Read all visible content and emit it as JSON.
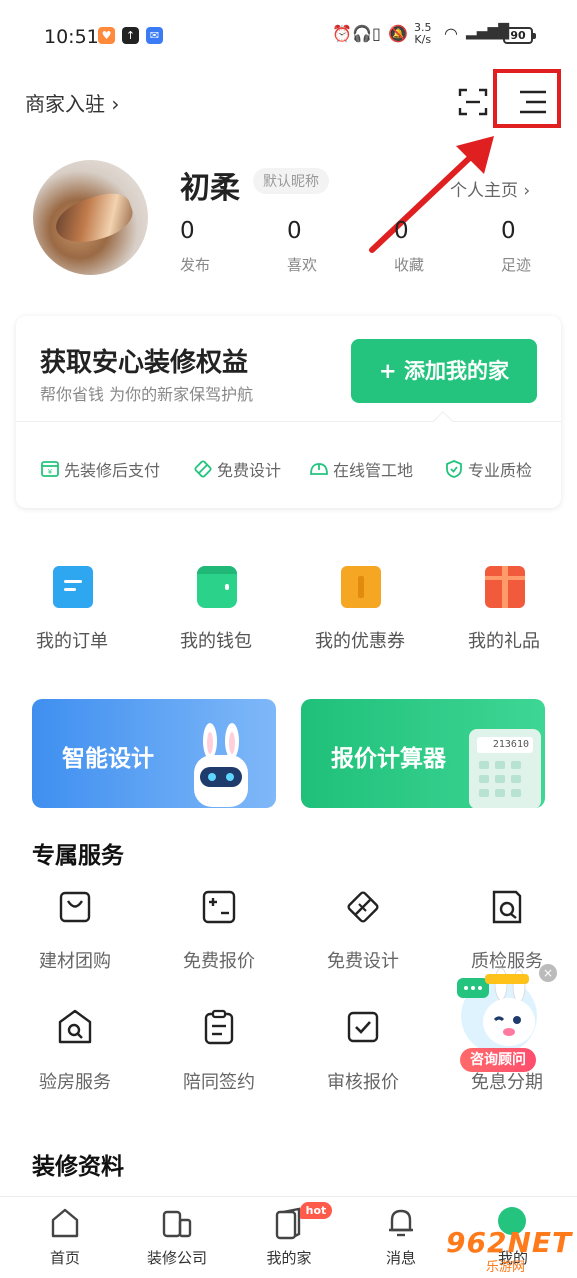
{
  "status_bar": {
    "time": "10:51",
    "net_speed_value": "3.5",
    "net_speed_unit": "K/s",
    "battery": "90"
  },
  "header": {
    "merchant_link": "商家入驻 ›"
  },
  "profile": {
    "username": "初柔",
    "nickname_badge": "默认昵称",
    "homepage_link": "个人主页 ›",
    "stats": [
      {
        "value": "0",
        "label": "发布"
      },
      {
        "value": "0",
        "label": "喜欢"
      },
      {
        "value": "0",
        "label": "收藏"
      },
      {
        "value": "0",
        "label": "足迹"
      }
    ]
  },
  "benefit": {
    "title": "获取安心装修权益",
    "subtitle": "帮你省钱 为你的新家保驾护航",
    "button": "+ 添加我的家",
    "features": [
      "先装修后支付",
      "免费设计",
      "在线管工地",
      "专业质检"
    ]
  },
  "quick_links": [
    {
      "label": "我的订单",
      "color": "#2fa6f0"
    },
    {
      "label": "我的钱包",
      "color": "#2bd38a"
    },
    {
      "label": "我的优惠券",
      "color": "#f5a623"
    },
    {
      "label": "我的礼品",
      "color": "#f25a3c"
    }
  ],
  "banners": {
    "design": "智能设计",
    "calculator": "报价计算器",
    "calculator_display": "213610"
  },
  "exclusive_services": {
    "title": "专属服务",
    "items": [
      {
        "label": "建材团购",
        "icon": "shopping-bag-icon"
      },
      {
        "label": "免费报价",
        "icon": "quote-icon"
      },
      {
        "label": "免费设计",
        "icon": "design-icon"
      },
      {
        "label": "质检服务",
        "icon": "inspection-icon"
      },
      {
        "label": "验房服务",
        "icon": "house-inspect-icon"
      },
      {
        "label": "陪同签约",
        "icon": "contract-icon"
      },
      {
        "label": "审核报价",
        "icon": "review-icon"
      },
      {
        "label": "免息分期",
        "icon": "installment-icon"
      }
    ]
  },
  "resources": {
    "title": "装修资料"
  },
  "consult": {
    "label": "咨询顾问",
    "close": "×"
  },
  "tabs": [
    {
      "label": "首页"
    },
    {
      "label": "装修公司"
    },
    {
      "label": "我的家",
      "badge": "hot"
    },
    {
      "label": "消息"
    },
    {
      "label": "我的"
    }
  ],
  "watermark": {
    "main": "962NET",
    "sub": "乐游网"
  },
  "colors": {
    "brand_green": "#24c47e",
    "highlight_red": "#e02020"
  }
}
